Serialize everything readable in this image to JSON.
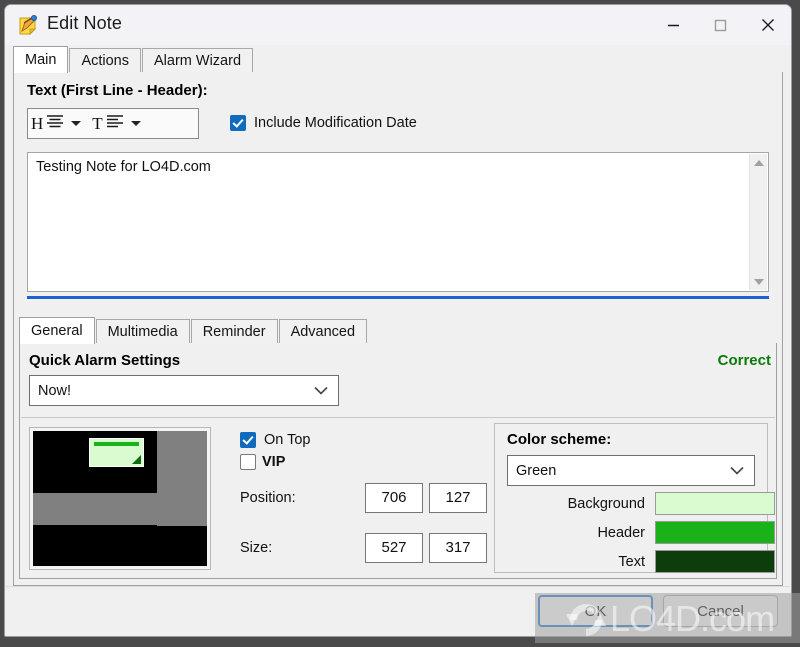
{
  "window": {
    "title": "Edit Note",
    "icon": "note-pencil-icon",
    "controls": {
      "minimize": "minimize-icon",
      "maximize": "maximize-icon",
      "close": "close-icon"
    }
  },
  "top_tabs": [
    {
      "label": "Main",
      "active": true
    },
    {
      "label": "Actions",
      "active": false
    },
    {
      "label": "Alarm Wizard",
      "active": false
    }
  ],
  "header_section": {
    "label": "Text (First Line - Header):",
    "toolbar": {
      "header_align_button": "H",
      "header_align_caret": "chevron-down-icon",
      "text_align_button": "T",
      "text_align_caret": "chevron-down-icon"
    },
    "include_modification_date": {
      "label": "Include Modification Date",
      "checked": true
    }
  },
  "editor": {
    "value": "Testing Note for LO4D.com",
    "scrollbar": {
      "up": "scroll-up-arrow-icon",
      "down": "scroll-down-arrow-icon"
    }
  },
  "bottom_tabs": [
    {
      "label": "General",
      "active": true
    },
    {
      "label": "Multimedia",
      "active": false
    },
    {
      "label": "Reminder",
      "active": false
    },
    {
      "label": "Advanced",
      "active": false
    }
  ],
  "general": {
    "quick_alarm_label": "Quick Alarm Settings",
    "quick_alarm_value": "Now!",
    "status_text": "Correct",
    "status_color": "#0a7a0a",
    "on_top": {
      "label": "On Top",
      "checked": true
    },
    "vip": {
      "label": "VIP",
      "checked": false
    },
    "position_label": "Position:",
    "position_x": "706",
    "position_y": "127",
    "size_label": "Size:",
    "size_w": "527",
    "size_h": "317",
    "preview": {
      "note_background": "#d8fcd0",
      "note_header": "#19b219",
      "desktop_background": "#000000",
      "wallpaper_band": "#808080"
    }
  },
  "color_scheme": {
    "label": "Color scheme:",
    "value": "Green",
    "rows": [
      {
        "label": "Background",
        "color": "#d8fcd0"
      },
      {
        "label": "Header",
        "color": "#19b219"
      },
      {
        "label": "Text",
        "color": "#0d3d0a"
      }
    ]
  },
  "buttons": {
    "ok": "OK",
    "cancel": "Cancel"
  },
  "watermark": {
    "text": "LO4D.com",
    "logo": "refresh-circle-icon"
  }
}
